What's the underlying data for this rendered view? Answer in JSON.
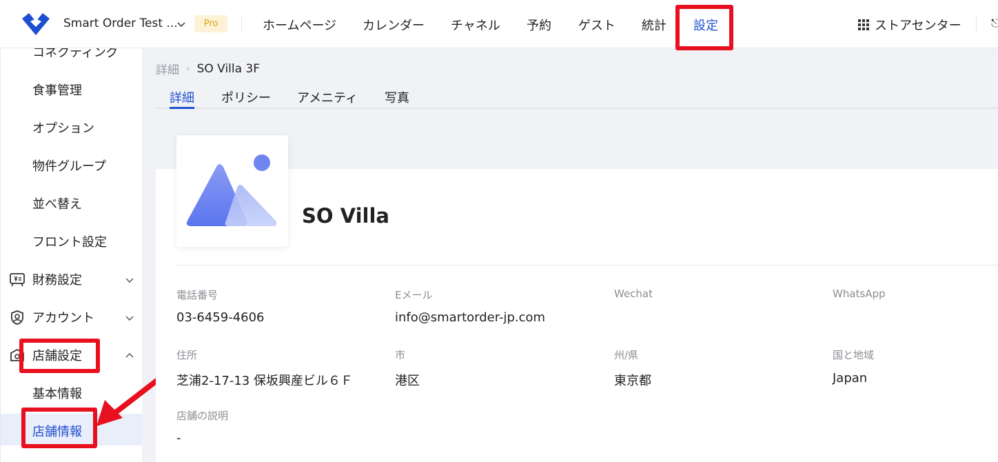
{
  "header": {
    "store_name": "Smart Order Test ...",
    "plan_badge": "Pro",
    "nav": [
      "ホームページ",
      "カレンダー",
      "チャネル",
      "予約",
      "ゲスト",
      "統計",
      "設定"
    ],
    "active_nav": "設定",
    "store_center": "ストアセンター"
  },
  "sidebar": {
    "items": [
      {
        "label": "コネクティング"
      },
      {
        "label": "食事管理"
      },
      {
        "label": "オプション"
      },
      {
        "label": "物件グループ"
      },
      {
        "label": "並べ替え"
      },
      {
        "label": "フロント設定"
      }
    ],
    "groups": [
      {
        "label": "財務設定",
        "icon": "finance-icon"
      },
      {
        "label": "アカウント",
        "icon": "account-icon"
      },
      {
        "label": "店舗設定",
        "icon": "store-icon"
      }
    ],
    "store_sub": [
      {
        "label": "基本情報"
      },
      {
        "label": "店舗情報"
      }
    ],
    "active_item": "店舗情報"
  },
  "breadcrumb": {
    "root": "詳細",
    "current": "SO Villa 3F"
  },
  "tabs": [
    "詳細",
    "ポリシー",
    "アメニティ",
    "写真"
  ],
  "active_tab": "詳細",
  "property": {
    "name": "SO Villa",
    "fields": [
      {
        "label": "電話番号",
        "value": "03-6459-4606"
      },
      {
        "label": "Eメール",
        "value": "info@smartorder-jp.com"
      },
      {
        "label": "Wechat",
        "value": ""
      },
      {
        "label": "WhatsApp",
        "value": ""
      },
      {
        "label": "住所",
        "value": "芝浦2-17-13 保坂興産ビル６Ｆ"
      },
      {
        "label": "市",
        "value": "港区"
      },
      {
        "label": "州/県",
        "value": "東京都"
      },
      {
        "label": "国と地域",
        "value": "Japan"
      },
      {
        "label": "店舗の説明",
        "value": "-"
      }
    ]
  },
  "colors": {
    "accent": "#1f4fd1",
    "highlight": "#e8101f",
    "pro_text": "#e0a21a",
    "pro_bg": "#fdf2d6"
  }
}
